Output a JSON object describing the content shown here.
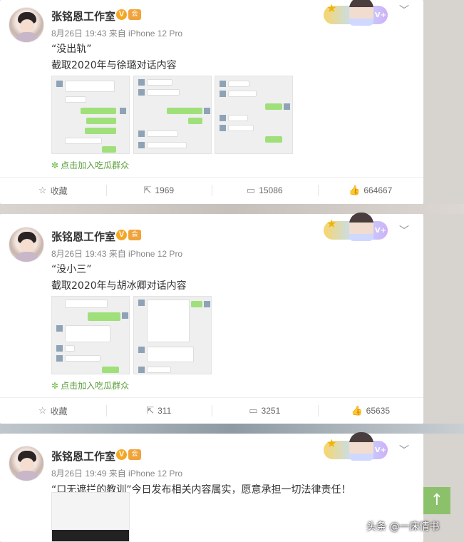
{
  "posts": [
    {
      "author": "张铭恩工作室",
      "verified_mark": "V",
      "vip_mark": "会",
      "meta": "8月26日 19:43 来自 iPhone 12 Pro",
      "line1": "“没出轨”",
      "line2": "截取2020年与徐璐对话内容",
      "join_label": "点击加入吃瓜群众",
      "actions": {
        "favorite": "收藏",
        "repost": "1969",
        "comment": "15086",
        "like": "664667"
      }
    },
    {
      "author": "张铭恩工作室",
      "verified_mark": "V",
      "vip_mark": "会",
      "meta": "8月26日 19:43 来自 iPhone 12 Pro",
      "line1": "“没小三”",
      "line2": "截取2020年与胡冰卿对话内容",
      "join_label": "点击加入吃瓜群众",
      "actions": {
        "favorite": "收藏",
        "repost": "311",
        "comment": "3251",
        "like": "65635"
      }
    },
    {
      "author": "张铭恩工作室",
      "verified_mark": "V",
      "vip_mark": "会",
      "meta": "8月26日 19:49 来自 iPhone 12 Pro",
      "line1": "“口无遮拦的教训”今日发布相关内容属实，愿意承担一切法律责任！"
    }
  ],
  "icons": {
    "favorite": "star-outline-icon",
    "repost": "repost-icon",
    "comment": "comment-icon",
    "like": "thumbs-up-icon",
    "menu": "chevron-down-icon",
    "scroll_top": "arrow-up-icon"
  },
  "colors": {
    "accent_green": "#8bc16b",
    "link_green": "#5a9e3a",
    "verified": "#f5a623"
  },
  "watermark": "头条 @一床情书"
}
